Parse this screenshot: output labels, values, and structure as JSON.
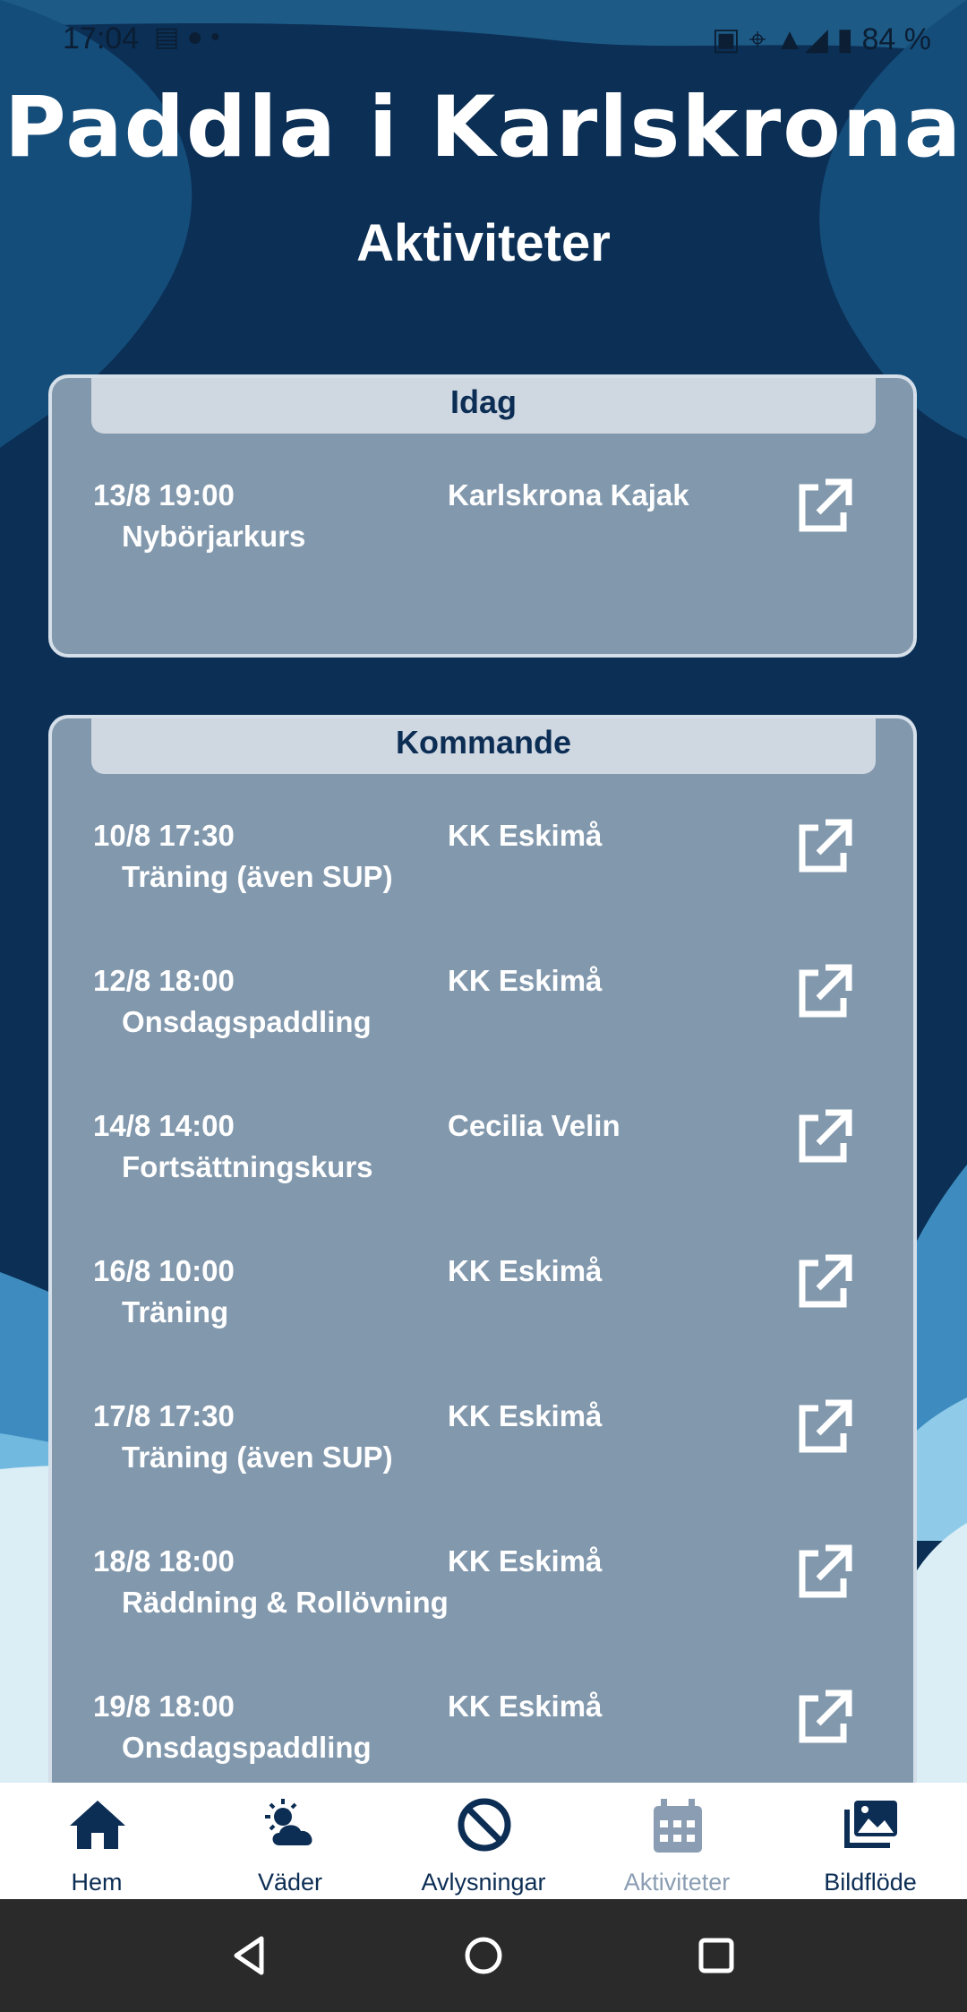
{
  "status_bar": {
    "time": "17:04",
    "battery": "84 %"
  },
  "header": {
    "app_title": "Paddla i Karlskrona",
    "page_title": "Aktiviteter"
  },
  "today": {
    "title": "Idag",
    "events": [
      {
        "datetime": "13/8 19:00",
        "name": "Nybörjarkurs",
        "organizer": "Karlskrona Kajak"
      }
    ]
  },
  "upcoming": {
    "title": "Kommande",
    "events": [
      {
        "datetime": "10/8 17:30",
        "name": "Träning (även SUP)",
        "organizer": "KK Eskimå"
      },
      {
        "datetime": "12/8 18:00",
        "name": "Onsdagspaddling",
        "organizer": "KK Eskimå"
      },
      {
        "datetime": "14/8 14:00",
        "name": "Fortsättningskurs",
        "organizer": "Cecilia Velin"
      },
      {
        "datetime": "16/8 10:00",
        "name": "Träning",
        "organizer": "KK Eskimå"
      },
      {
        "datetime": "17/8 17:30",
        "name": "Träning (även SUP)",
        "organizer": "KK Eskimå"
      },
      {
        "datetime": "18/8 18:00",
        "name": "Räddning & Rollövning",
        "organizer": "KK Eskimå"
      },
      {
        "datetime": "19/8 18:00",
        "name": "Onsdagspaddling",
        "organizer": "KK Eskimå"
      }
    ]
  },
  "tabs": [
    {
      "label": "Hem",
      "icon": "home-icon"
    },
    {
      "label": "Väder",
      "icon": "weather-icon"
    },
    {
      "label": "Avlysningar",
      "icon": "cancel-icon"
    },
    {
      "label": "Aktiviteter",
      "icon": "calendar-icon",
      "active": true
    },
    {
      "label": "Bildflöde",
      "icon": "images-icon"
    }
  ],
  "colors": {
    "navy": "#0c2d54",
    "card": "#8298ad",
    "header": "#cfd7e1",
    "inactive_tab": "#8a9db2"
  }
}
